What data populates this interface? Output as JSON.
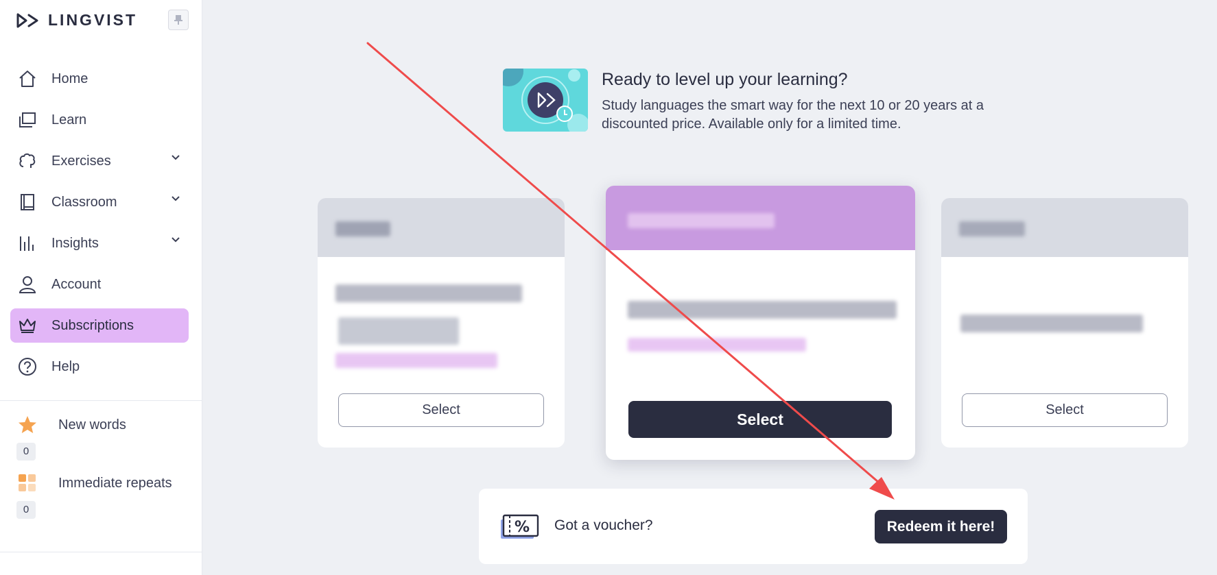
{
  "app": {
    "name": "LINGVIST"
  },
  "sidebar": {
    "items": [
      {
        "label": "Home",
        "icon": "home-icon"
      },
      {
        "label": "Learn",
        "icon": "learn-icon"
      },
      {
        "label": "Exercises",
        "icon": "brain-icon",
        "expandable": true
      },
      {
        "label": "Classroom",
        "icon": "book-icon",
        "expandable": true
      },
      {
        "label": "Insights",
        "icon": "bar-chart-icon",
        "expandable": true
      },
      {
        "label": "Account",
        "icon": "user-icon"
      },
      {
        "label": "Subscriptions",
        "icon": "crown-icon",
        "active": true
      },
      {
        "label": "Help",
        "icon": "help-icon"
      }
    ],
    "stats": [
      {
        "label": "New words",
        "count": "0",
        "icon": "star-icon"
      },
      {
        "label": "Immediate repeats",
        "count": "0",
        "icon": "grid-icon"
      }
    ]
  },
  "promo": {
    "title": "Ready to level up your learning?",
    "description": "Study languages the smart way for the next 10 or 20 years at a discounted price. Available only for a limited time."
  },
  "plans": [
    {
      "select_label": "Select",
      "featured": false
    },
    {
      "select_label": "Select",
      "featured": true
    },
    {
      "select_label": "Select",
      "featured": false
    }
  ],
  "voucher": {
    "text": "Got a voucher?",
    "button_label": "Redeem it here!"
  },
  "colors": {
    "accent": "#e2b6f7",
    "featured_header": "#c89ae0",
    "dark": "#2a2d40",
    "promo_bg": "#5fd8dc",
    "annotation_arrow": "#ef4b4b"
  }
}
